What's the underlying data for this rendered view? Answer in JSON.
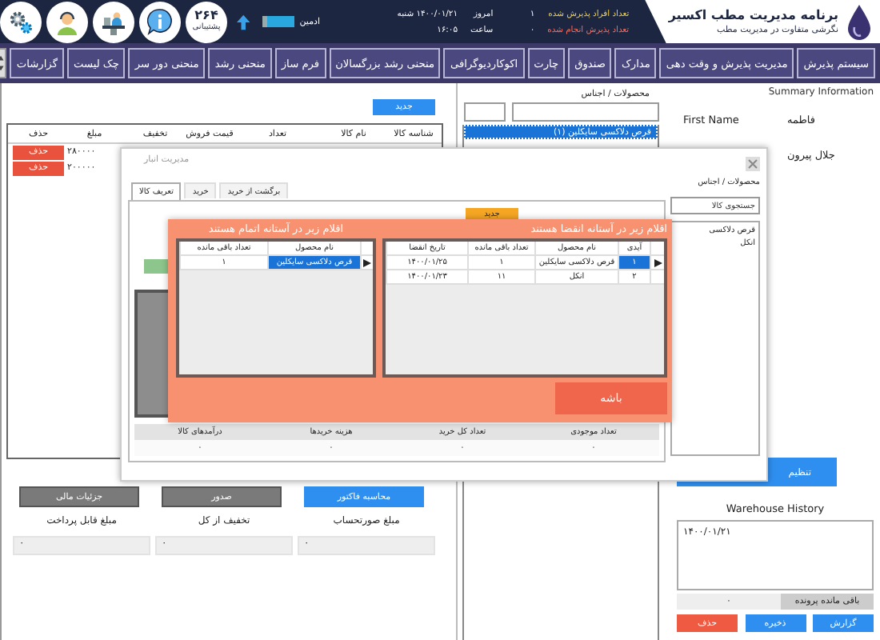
{
  "header": {
    "title": "برنامه مدیریت مطب اکسیر",
    "subtitle": "نگرشی متفاوت در مدیریت مطب",
    "stats": [
      {
        "kind": "admitted",
        "label": "تعداد افراد پذیرش شده",
        "value": "۱",
        "info_label": "امروز",
        "info_value": "۱۴۰۰/۰۱/۲۱ شنبه"
      },
      {
        "kind": "done",
        "label": "تعداد پذیرش انجام شده",
        "value": "۰",
        "info_label": "ساعت",
        "info_value": "۱۶:۰۵"
      }
    ],
    "user": "ادمین",
    "support_number": "۲۶۴",
    "support_label": "پشتیبانی"
  },
  "menu": [
    "سیستم پذیرش",
    "مدیریت پذیرش و وقت دهی",
    "مدارک",
    "صندوق",
    "چارت",
    "اکوکاردیوگرافی",
    "منحنی رشد بزرگسالان",
    "فرم ساز",
    "منحنی رشد",
    "منحنی دور سر",
    "چک لیست",
    "گزارشات"
  ],
  "invoice": {
    "new_button": "جدید",
    "columns": [
      "شناسه کالا",
      "نام کالا",
      "تعداد",
      "قیمت فروش",
      "تخفیف",
      "مبلغ",
      "حذف"
    ],
    "rows": [
      {
        "amount": "۲۸۰۰۰۰",
        "delete": "حذف"
      },
      {
        "amount": "۲۰۰۰۰۰",
        "delete": "حذف"
      }
    ],
    "actions": [
      {
        "label": "محاسبه فاکتور",
        "kind": "primary"
      },
      {
        "label": "صدور",
        "kind": "secondary"
      },
      {
        "label": "جزئیات مالی",
        "kind": "secondary"
      }
    ],
    "totals": [
      {
        "label": "مبلغ صورتحساب",
        "value": "۰"
      },
      {
        "label": "تخفیف از کل",
        "value": "۰"
      },
      {
        "label": "مبلغ قابل پرداخت",
        "value": "۰"
      }
    ]
  },
  "products": {
    "label": "محصولات / اجناس",
    "items": [
      {
        "label": "قرص دلاکسی سایکلین (۱)",
        "selected": true
      }
    ]
  },
  "summary": {
    "title": "Summary Information",
    "fields": [
      {
        "label": "First Name",
        "value": "فاطمه"
      },
      {
        "value": "جلال پیرون"
      }
    ],
    "settings_button": "تنظیم",
    "history_title": "Warehouse History",
    "history": "۱۴۰۰/۰۱/۲۱",
    "remaining_label": "باقی مانده پرونده",
    "remaining_value": "۰",
    "buttons": [
      {
        "label": "گزارش",
        "kind": "primary"
      },
      {
        "label": "ذخیره",
        "kind": "primary"
      },
      {
        "label": "حذف",
        "kind": "danger"
      }
    ]
  },
  "stock_dialog": {
    "title": "مدیریت انبار",
    "tabs": [
      {
        "label": "برگشت از خرید",
        "selected": false
      },
      {
        "label": "خرید",
        "selected": false
      },
      {
        "label": "تعریف کالا",
        "selected": true
      }
    ],
    "new_button": "جدید",
    "products_label": "محصولات / اجناس",
    "search": {
      "placeholder": "جستجوی کالا"
    },
    "product_list": [
      "قرص دلاکسی",
      "انکل"
    ],
    "stats_columns": [
      "تعداد موجودی",
      "تعداد کل خرید",
      "هزینه خریدها",
      "درآمدهای کالا"
    ],
    "stats_values": [
      "۰",
      "۰",
      "۰",
      "۰"
    ]
  },
  "alert": {
    "expiry": {
      "title": "اقلام زیر در آستانه انقضا هستند",
      "columns": [
        "آیدی",
        "نام محصول",
        "تعداد باقی مانده",
        "تاریخ انقضا"
      ],
      "rows": [
        {
          "selected": true,
          "cells": [
            "۱",
            "قرص دلاکسی سایکلین",
            "۱",
            "۱۴۰۰/۰۱/۲۵"
          ]
        },
        {
          "selected": false,
          "cells": [
            "۲",
            "انکل",
            "۱۱",
            "۱۴۰۰/۰۱/۲۳"
          ]
        }
      ]
    },
    "low_stock": {
      "title": "اقلام زیر در آستانه اتمام هستند",
      "columns": [
        "نام محصول",
        "تعداد باقی مانده"
      ],
      "rows": [
        {
          "selected": true,
          "cells": [
            "قرص دلاکسی سایکلین",
            "۱"
          ]
        }
      ]
    },
    "ok_button": "باشه"
  }
}
